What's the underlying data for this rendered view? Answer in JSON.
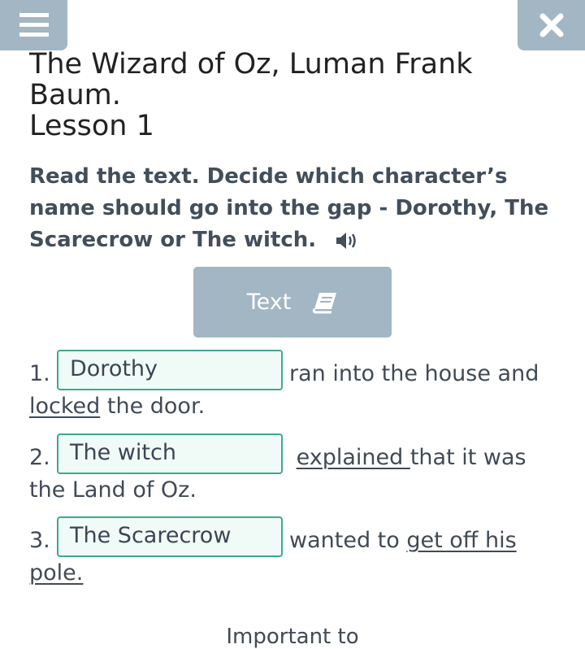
{
  "title_line1": "The Wizard of Oz, Luman Frank Baum.",
  "title_line2": "Lesson 1",
  "instruction": "Read the text. Decide which character’s name should go into the gap - Dorothy, The Scarecrow or The witch.",
  "text_button_label": "Text",
  "items": [
    {
      "number": "1.",
      "answer": "Dorothy",
      "after": "ran into the house and",
      "line2_underlined": "locked",
      "line2_rest": " the door."
    },
    {
      "number": "2.",
      "answer": "The witch",
      "after_underlined": "explained ",
      "after_rest": "that it was",
      "line2": "the Land of Oz."
    },
    {
      "number": "3.",
      "answer": "The Scarecrow",
      "after": "wanted to ",
      "after_underlined": "get off his",
      "line2_underlined": "pole."
    }
  ],
  "footer_partial": "Important to",
  "icons": {
    "menu": "hamburger-menu-icon",
    "close": "close-icon",
    "audio": "speaker-icon",
    "book": "book-icon"
  },
  "colors": {
    "button_bg": "#a2b6c4",
    "gap_border": "#3aaa90",
    "gap_bg": "#f0faf6"
  }
}
